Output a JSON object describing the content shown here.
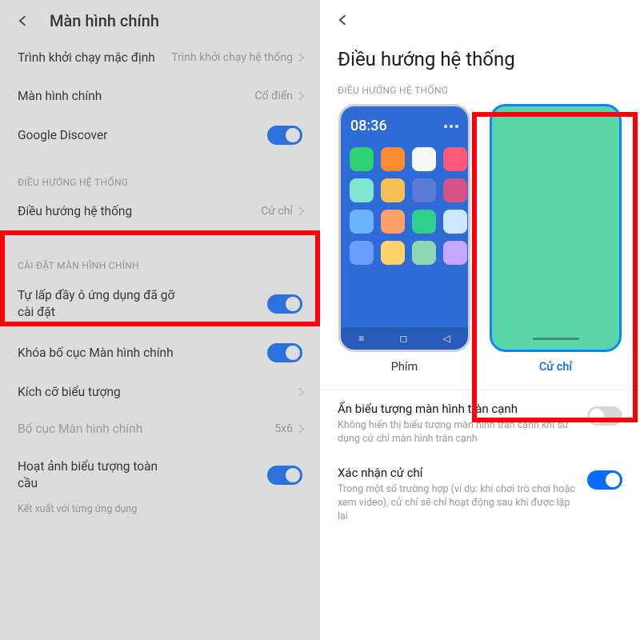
{
  "left": {
    "title": "Màn hình chính",
    "launcher": {
      "label": "Trình khởi chạy mặc định",
      "value": "Trình khởi chạy hệ thống"
    },
    "homescreen": {
      "label": "Màn hình chính",
      "value": "Cổ điển"
    },
    "discover": {
      "label": "Google Discover"
    },
    "navSection": "ĐIỀU HƯỚNG HỆ THỐNG",
    "systemNav": {
      "label": "Điều hướng hệ thống",
      "value": "Cử chỉ"
    },
    "settingsSection": "CÀI ĐẶT MÀN HÌNH CHÍNH",
    "fill": {
      "label": "Tự lấp đầy ô ứng dụng đã gỡ cài đặt"
    },
    "lock": {
      "label": "Khóa bố cục Màn hình chính"
    },
    "iconSize": {
      "label": "Kích cỡ biểu tượng"
    },
    "layout": {
      "label": "Bố cục Màn hình chính",
      "value": "5x6"
    },
    "globalAnim": {
      "label": "Hoạt ảnh biểu tượng toàn cầu"
    }
  },
  "right": {
    "title": "Điều hướng hệ thống",
    "navSection": "ĐIỀU HƯỚNG HỆ THỐNG",
    "time": "08:36",
    "cards": {
      "buttons": "Phím",
      "gestures": "Cử chỉ"
    },
    "hideFull": {
      "title": "Ẩn biểu tượng màn hình tràn cạnh",
      "desc": "Không hiển thị biểu tượng màn hình tràn cạnh khi sử dụng cử chỉ màn hình tràn cạnh"
    },
    "confirmGesture": {
      "title": "Xác nhận cử chỉ",
      "desc": "Trong một số trường hợp (ví dụ: khi chơi trò chơi hoặc xem video), cử chỉ sẽ chỉ hoạt động sau khi được lặp lại"
    },
    "subtext": "Kết xuất với từng ứng dụng"
  },
  "appColors": [
    "#2fd172",
    "#ff8a34",
    "#f6f6f6",
    "#ff5a7a",
    "#7fe6cf",
    "#f6c152",
    "#5c7bd6",
    "#d75286",
    "#6bb2ff",
    "#ff9f6a",
    "#2fcf8e",
    "#cfe8ff",
    "#6b9cff",
    "#ffd56b",
    "#8cd7b2",
    "#c4a8ff"
  ]
}
